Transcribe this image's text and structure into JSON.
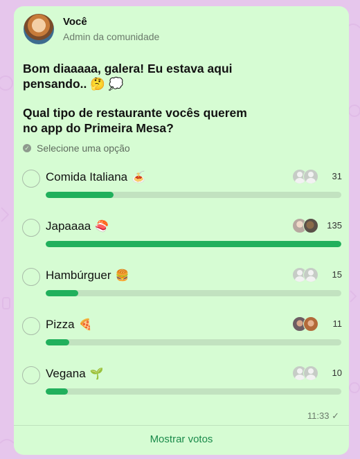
{
  "post": {
    "author": "Você",
    "role": "Admin da comunidade",
    "message": "Bom diaaaaa, galera! Eu estava aqui pensando.. 🤔 💭",
    "question": "Qual tipo de restaurante vocês querem no app do Primeira Mesa?",
    "select_hint": "Selecione uma opção",
    "time": "11:33 ✓",
    "show_votes": "Mostrar votos"
  },
  "options": [
    {
      "label": "Comida Italiana",
      "emoji": "🍝",
      "votes": "31",
      "fraction": 0.23
    },
    {
      "label": "Japaaaa",
      "emoji": "🍣",
      "votes": "135",
      "fraction": 1.0
    },
    {
      "label": "Hambúrguer",
      "emoji": "🍔",
      "votes": "15",
      "fraction": 0.11
    },
    {
      "label": "Pizza",
      "emoji": "🍕",
      "votes": "11",
      "fraction": 0.08
    },
    {
      "label": "Vegana",
      "emoji": "🌱",
      "votes": "10",
      "fraction": 0.075
    }
  ]
}
